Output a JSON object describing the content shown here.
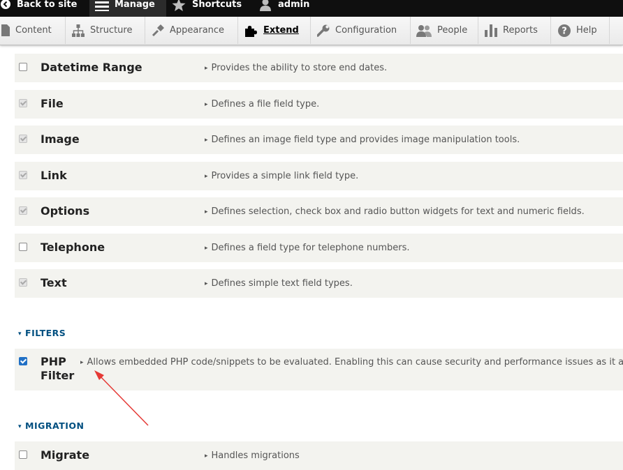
{
  "toolbar": {
    "back_label": "Back to site",
    "manage_label": "Manage",
    "shortcuts_label": "Shortcuts",
    "user_label": "admin"
  },
  "tray": {
    "items": [
      {
        "label": "Content",
        "icon": "page-icon"
      },
      {
        "label": "Structure",
        "icon": "sitemap-icon"
      },
      {
        "label": "Appearance",
        "icon": "paintbrush-icon"
      },
      {
        "label": "Extend",
        "icon": "puzzle-icon",
        "active": true
      },
      {
        "label": "Configuration",
        "icon": "wrench-icon"
      },
      {
        "label": "People",
        "icon": "people-icon"
      },
      {
        "label": "Reports",
        "icon": "bar-chart-icon"
      },
      {
        "label": "Help",
        "icon": "help-icon"
      }
    ]
  },
  "modules": [
    {
      "name": "Datetime Range",
      "description": "Provides the ability to store end dates.",
      "state": "unchecked"
    },
    {
      "name": "File",
      "description": "Defines a file field type.",
      "state": "checked-disabled"
    },
    {
      "name": "Image",
      "description": "Defines an image field type and provides image manipulation tools.",
      "state": "checked-disabled"
    },
    {
      "name": "Link",
      "description": "Provides a simple link field type.",
      "state": "checked-disabled"
    },
    {
      "name": "Options",
      "description": "Defines selection, check box and radio button widgets for text and numeric fields.",
      "state": "checked-disabled"
    },
    {
      "name": "Telephone",
      "description": "Defines a field type for telephone numbers.",
      "state": "unchecked"
    },
    {
      "name": "Text",
      "description": "Defines simple text field types.",
      "state": "checked-disabled"
    }
  ],
  "filters_section": {
    "title": "FILTERS",
    "module": {
      "name_line1": "PHP",
      "name_line2": "Filter",
      "description": "Allows embedded PHP code/snippets to be evaluated. Enabling this can cause security and performance issues as it a",
      "state": "checked"
    }
  },
  "migration_section": {
    "title": "MIGRATION",
    "module": {
      "name": "Migrate",
      "description": "Handles migrations",
      "state": "unchecked"
    }
  },
  "colors": {
    "toolbar_bg": "#0f0f0f",
    "section_title": "#004f80",
    "row_bg": "#f3f3ef",
    "checkbox_checked": "#2170c5",
    "annotation_arrow": "#e53935"
  }
}
